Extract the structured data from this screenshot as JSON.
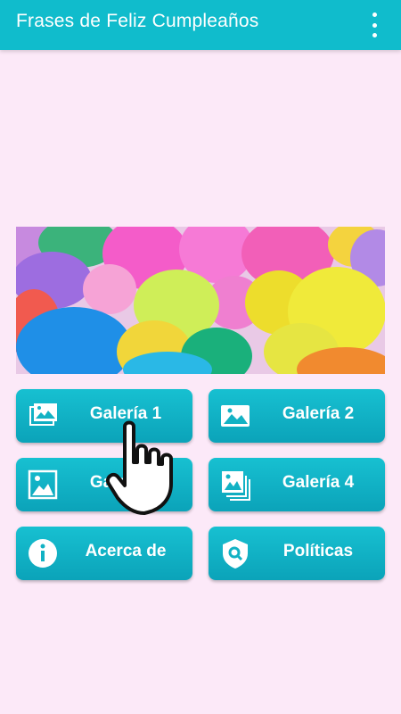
{
  "appbar": {
    "title": "Frases de Feliz Cumpleaños",
    "menu_icon": "more-vert-icon",
    "color": "#10bccc"
  },
  "banner": {
    "description_icon": "balloons-image"
  },
  "buttons": [
    {
      "label": "Galería 1",
      "icon": "gallery-icon"
    },
    {
      "label": "Galería 2",
      "icon": "image-icon"
    },
    {
      "label": "Galería 3",
      "icon": "photo-icon"
    },
    {
      "label": "Galería 4",
      "icon": "photo-stack-icon"
    },
    {
      "label": "Acerca de",
      "icon": "info-icon"
    },
    {
      "label": "Políticas",
      "icon": "shield-search-icon"
    }
  ],
  "colors": {
    "background": "#fce9f8",
    "button": "#10bccc",
    "text": "#ffffff"
  },
  "overlay": {
    "icon": "hand-pointer-icon"
  }
}
